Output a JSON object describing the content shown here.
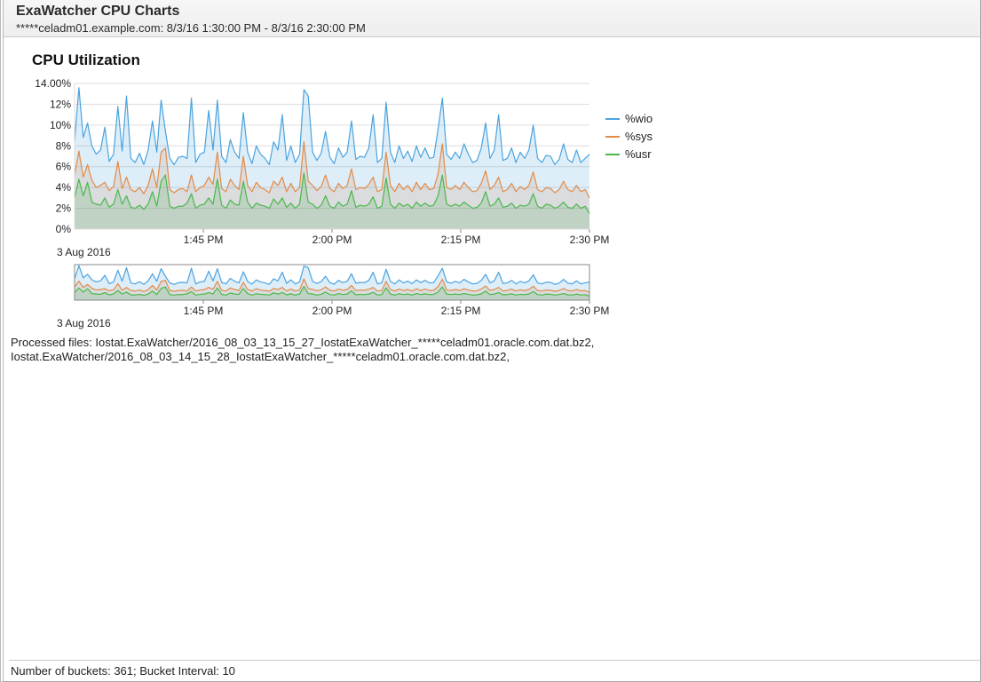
{
  "header": {
    "title": "ExaWatcher CPU Charts",
    "subtitle": "*****celadm01.example.com: 8/3/16 1:30:00 PM - 8/3/16 2:30:00 PM"
  },
  "chart_title": "CPU Utilization",
  "processed_files": "Processed files: Iostat.ExaWatcher/2016_08_03_13_15_27_IostatExaWatcher_*****celadm01.oracle.com.dat.bz2, Iostat.ExaWatcher/2016_08_03_14_15_28_IostatExaWatcher_*****celadm01.oracle.com.dat.bz2,",
  "status_bar": "Number of buckets: 361; Bucket Interval: 10",
  "legend": {
    "wio": "%wio",
    "sys": "%sys",
    "usr": "%usr"
  },
  "colors": {
    "wio": "#4aa3df",
    "sys": "#e38b47",
    "usr": "#4bb84b",
    "wio_fill": "rgba(74,163,223,0.18)",
    "sys_fill": "rgba(227,139,71,0.18)",
    "usr_fill": "rgba(75,184,75,0.22)",
    "grid": "#dddddd",
    "axis": "#666666"
  },
  "chart_data": {
    "type": "area",
    "title": "CPU Utilization",
    "xlabel": "",
    "ylabel": "",
    "ylim": [
      0,
      14
    ],
    "y_ticks": [
      0,
      2,
      4,
      6,
      8,
      10,
      12,
      14
    ],
    "y_tick_labels": [
      "0%",
      "2%",
      "4%",
      "6%",
      "8%",
      "10%",
      "12%",
      "14.00%"
    ],
    "x_tick_labels": [
      "1:45 PM",
      "2:00 PM",
      "2:15 PM",
      "2:30 PM"
    ],
    "x_tick_positions_min": [
      15,
      30,
      45,
      60
    ],
    "x_range_min": [
      0,
      60
    ],
    "date_label": "3 Aug 2016",
    "series": [
      {
        "name": "%usr",
        "values": [
          3.0,
          4.8,
          3.2,
          4.5,
          2.6,
          2.4,
          2.3,
          3.0,
          2.1,
          2.4,
          3.8,
          2.4,
          3.2,
          2.1,
          2.0,
          2.3,
          1.9,
          2.4,
          3.6,
          2.2,
          4.6,
          5.2,
          2.2,
          2.0,
          2.2,
          2.2,
          2.5,
          3.4,
          2.0,
          2.3,
          2.4,
          3.0,
          2.4,
          4.8,
          2.3,
          2.0,
          2.8,
          2.4,
          2.3,
          4.6,
          2.6,
          2.0,
          2.5,
          2.3,
          2.2,
          2.0,
          2.9,
          2.4,
          3.0,
          2.1,
          2.5,
          2.0,
          2.4,
          5.4,
          2.6,
          2.4,
          2.0,
          2.3,
          3.2,
          2.2,
          2.0,
          2.6,
          2.2,
          2.4,
          3.7,
          2.1,
          2.3,
          2.2,
          2.4,
          3.1,
          2.0,
          2.2,
          4.9,
          2.4,
          2.0,
          2.5,
          2.2,
          2.4,
          2.0,
          2.6,
          2.2,
          2.5,
          2.2,
          2.3,
          3.2,
          5.2,
          2.4,
          2.2,
          2.4,
          2.2,
          2.6,
          2.3,
          2.0,
          2.1,
          2.5,
          3.6,
          2.2,
          2.4,
          3.0,
          2.1,
          2.2,
          2.5,
          2.0,
          2.3,
          2.2,
          2.4,
          3.4,
          2.2,
          2.0,
          2.4,
          2.3,
          2.0,
          2.2,
          2.6,
          2.1,
          2.0,
          2.4,
          2.0,
          2.2,
          1.5
        ]
      },
      {
        "name": "%sys",
        "values": [
          5.2,
          7.5,
          5.0,
          6.2,
          4.7,
          4.0,
          4.2,
          4.5,
          3.7,
          4.1,
          6.5,
          3.9,
          5.0,
          3.8,
          3.6,
          4.0,
          3.4,
          4.2,
          5.8,
          4.0,
          7.4,
          7.8,
          3.8,
          3.5,
          3.8,
          3.9,
          3.6,
          5.2,
          3.6,
          4.0,
          4.2,
          5.0,
          4.3,
          7.4,
          3.9,
          3.6,
          4.8,
          4.2,
          3.8,
          7.0,
          4.2,
          3.6,
          4.5,
          4.0,
          3.8,
          3.5,
          4.6,
          4.2,
          5.0,
          3.6,
          4.4,
          3.6,
          4.0,
          8.4,
          4.6,
          4.2,
          3.7,
          4.1,
          5.2,
          3.9,
          3.6,
          4.4,
          3.9,
          4.2,
          5.8,
          3.8,
          4.0,
          3.9,
          4.3,
          5.0,
          3.6,
          3.8,
          7.4,
          4.2,
          3.6,
          4.4,
          3.8,
          4.2,
          3.6,
          4.5,
          3.8,
          4.4,
          3.8,
          3.9,
          5.3,
          8.2,
          4.0,
          3.8,
          4.2,
          3.8,
          4.5,
          4.0,
          3.6,
          3.7,
          4.4,
          5.6,
          3.8,
          4.2,
          5.0,
          3.6,
          3.8,
          4.4,
          3.6,
          4.1,
          3.8,
          4.2,
          5.5,
          3.8,
          3.6,
          4.0,
          3.9,
          3.5,
          3.8,
          4.6,
          3.8,
          3.6,
          4.2,
          3.6,
          3.8,
          3.0
        ]
      },
      {
        "name": "%wio",
        "values": [
          8.4,
          13.6,
          8.8,
          10.2,
          8.0,
          7.2,
          7.6,
          9.8,
          6.5,
          7.2,
          11.8,
          7.5,
          12.8,
          6.8,
          6.4,
          7.3,
          6.2,
          7.6,
          10.4,
          7.4,
          12.4,
          9.4,
          6.8,
          6.2,
          6.9,
          7.0,
          6.8,
          12.6,
          6.4,
          7.2,
          7.4,
          11.4,
          7.6,
          12.4,
          7.0,
          6.4,
          8.6,
          7.4,
          6.8,
          11.2,
          7.4,
          6.3,
          8.0,
          7.2,
          6.8,
          6.2,
          8.4,
          7.6,
          11.0,
          6.6,
          8.0,
          6.4,
          7.2,
          13.4,
          12.8,
          7.4,
          6.6,
          7.3,
          9.4,
          6.9,
          6.3,
          7.8,
          6.9,
          7.4,
          10.4,
          6.7,
          7.0,
          6.9,
          7.8,
          11.0,
          6.4,
          6.8,
          12.2,
          7.4,
          6.4,
          8.0,
          6.8,
          7.5,
          6.5,
          8.0,
          6.9,
          7.8,
          6.8,
          6.9,
          9.6,
          12.6,
          7.2,
          6.7,
          7.4,
          6.8,
          8.2,
          7.2,
          6.4,
          6.6,
          7.8,
          10.2,
          6.8,
          7.6,
          11.0,
          6.6,
          6.8,
          7.8,
          6.4,
          7.4,
          6.8,
          7.6,
          10.0,
          6.8,
          6.4,
          7.1,
          7.0,
          6.2,
          6.7,
          8.2,
          6.7,
          6.4,
          7.6,
          6.4,
          6.8,
          7.2
        ]
      }
    ]
  },
  "overview": {
    "x_tick_labels": [
      "1:45 PM",
      "2:00 PM",
      "2:15 PM",
      "2:30 PM"
    ],
    "date_label": "3 Aug 2016"
  }
}
